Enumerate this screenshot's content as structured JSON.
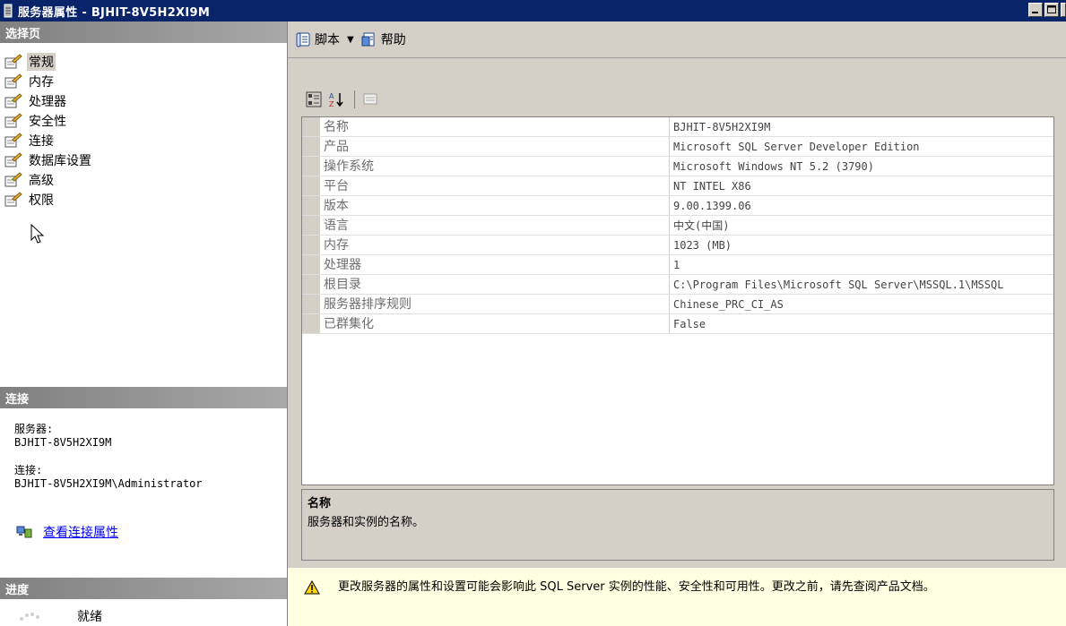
{
  "window": {
    "title": "服务器属性 - BJHIT-8V5H2XI9M"
  },
  "left_panel": {
    "select_page_header": "选择页",
    "pages": [
      {
        "label": "常规",
        "selected": true
      },
      {
        "label": "内存"
      },
      {
        "label": "处理器"
      },
      {
        "label": "安全性"
      },
      {
        "label": "连接"
      },
      {
        "label": "数据库设置"
      },
      {
        "label": "高级"
      },
      {
        "label": "权限"
      }
    ],
    "connection_header": "连接",
    "server_label": "服务器:",
    "server_value": "BJHIT-8V5H2XI9M",
    "connection_label": "连接:",
    "connection_value": "BJHIT-8V5H2XI9M\\Administrator",
    "view_connection_link": "查看连接属性",
    "progress_header": "进度",
    "progress_status": "就绪"
  },
  "toolbar": {
    "script_label": "脚本",
    "help_label": "帮助"
  },
  "properties": [
    {
      "name": "名称",
      "value": "BJHIT-8V5H2XI9M"
    },
    {
      "name": "产品",
      "value": "Microsoft SQL Server Developer Edition"
    },
    {
      "name": "操作系统",
      "value": "Microsoft Windows NT 5.2 (3790)"
    },
    {
      "name": "平台",
      "value": "NT INTEL X86"
    },
    {
      "name": "版本",
      "value": "9.00.1399.06"
    },
    {
      "name": "语言",
      "value": "中文(中国)"
    },
    {
      "name": "内存",
      "value": "1023 (MB)"
    },
    {
      "name": "处理器",
      "value": "1"
    },
    {
      "name": "根目录",
      "value": "C:\\Program Files\\Microsoft SQL Server\\MSSQL.1\\MSSQL"
    },
    {
      "name": "服务器排序规则",
      "value": "Chinese_PRC_CI_AS"
    },
    {
      "name": "已群集化",
      "value": "False"
    }
  ],
  "description": {
    "title": "名称",
    "text": "服务器和实例的名称。"
  },
  "warning": {
    "text": "更改服务器的属性和设置可能会影响此 SQL Server 实例的性能、安全性和可用性。更改之前，请先查阅产品文档。"
  },
  "colors": {
    "titlebar": "#0a246a",
    "panel": "#d4d0c8",
    "warning_bg": "#ffffe1",
    "link": "#0000ee"
  }
}
